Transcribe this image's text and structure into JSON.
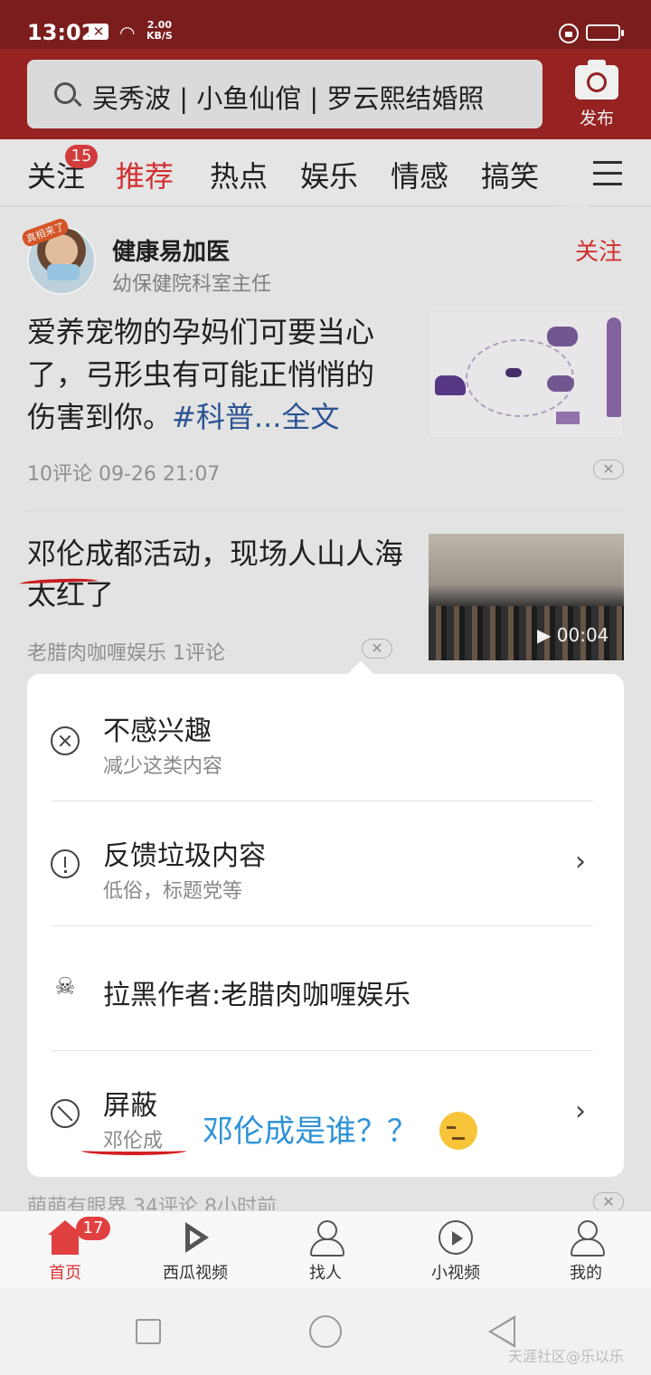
{
  "status_bar": {
    "time": "13:02",
    "notification_badge": "✕",
    "wifi_icon": "wifi-icon",
    "speed_value": "2.00",
    "speed_unit": "KB/S"
  },
  "header": {
    "search_text": "吴秀波 | 小鱼仙倌 | 罗云熙结婚照",
    "publish_label": "发布",
    "accent_color": "#a02525"
  },
  "tabs": {
    "items": [
      "关注",
      "推荐",
      "热点",
      "娱乐",
      "情感",
      "搞笑"
    ],
    "active": "推荐",
    "follow_badge": "15"
  },
  "feed": {
    "post1": {
      "author": "健康易加医",
      "author_sub": "幼保健院科室主任",
      "avatar_tag": "真相来了",
      "follow_label": "关注",
      "text": "爱养宠物的孕妈们可要当心了，弓形虫有可能正悄悄的伤害到你。",
      "hashtag": "#科普",
      "more": "...全文",
      "meta": "10评论   09-26 21:07"
    },
    "post2": {
      "title": "邓伦成都活动，现场人山人海太红了",
      "meta": "老腊肉咖喱娱乐  1评论",
      "duration": "00:04"
    },
    "peek": "萌萌有眼界  34评论  8小时前"
  },
  "popup": {
    "items": [
      {
        "title": "不感兴趣",
        "sub": "减少这类内容"
      },
      {
        "title": "反馈垃圾内容",
        "sub": "低俗，标题党等"
      },
      {
        "title": "拉黑作者:老腊肉咖喱娱乐",
        "sub": ""
      },
      {
        "title": "屏蔽",
        "sub": "邓伦成"
      }
    ],
    "annotation": "邓伦成是谁？？"
  },
  "bottom_nav": {
    "items": [
      "首页",
      "西瓜视频",
      "找人",
      "小视频",
      "我的"
    ],
    "active": "首页",
    "home_badge": "17"
  },
  "watermark": "天涯社区@乐以乐"
}
